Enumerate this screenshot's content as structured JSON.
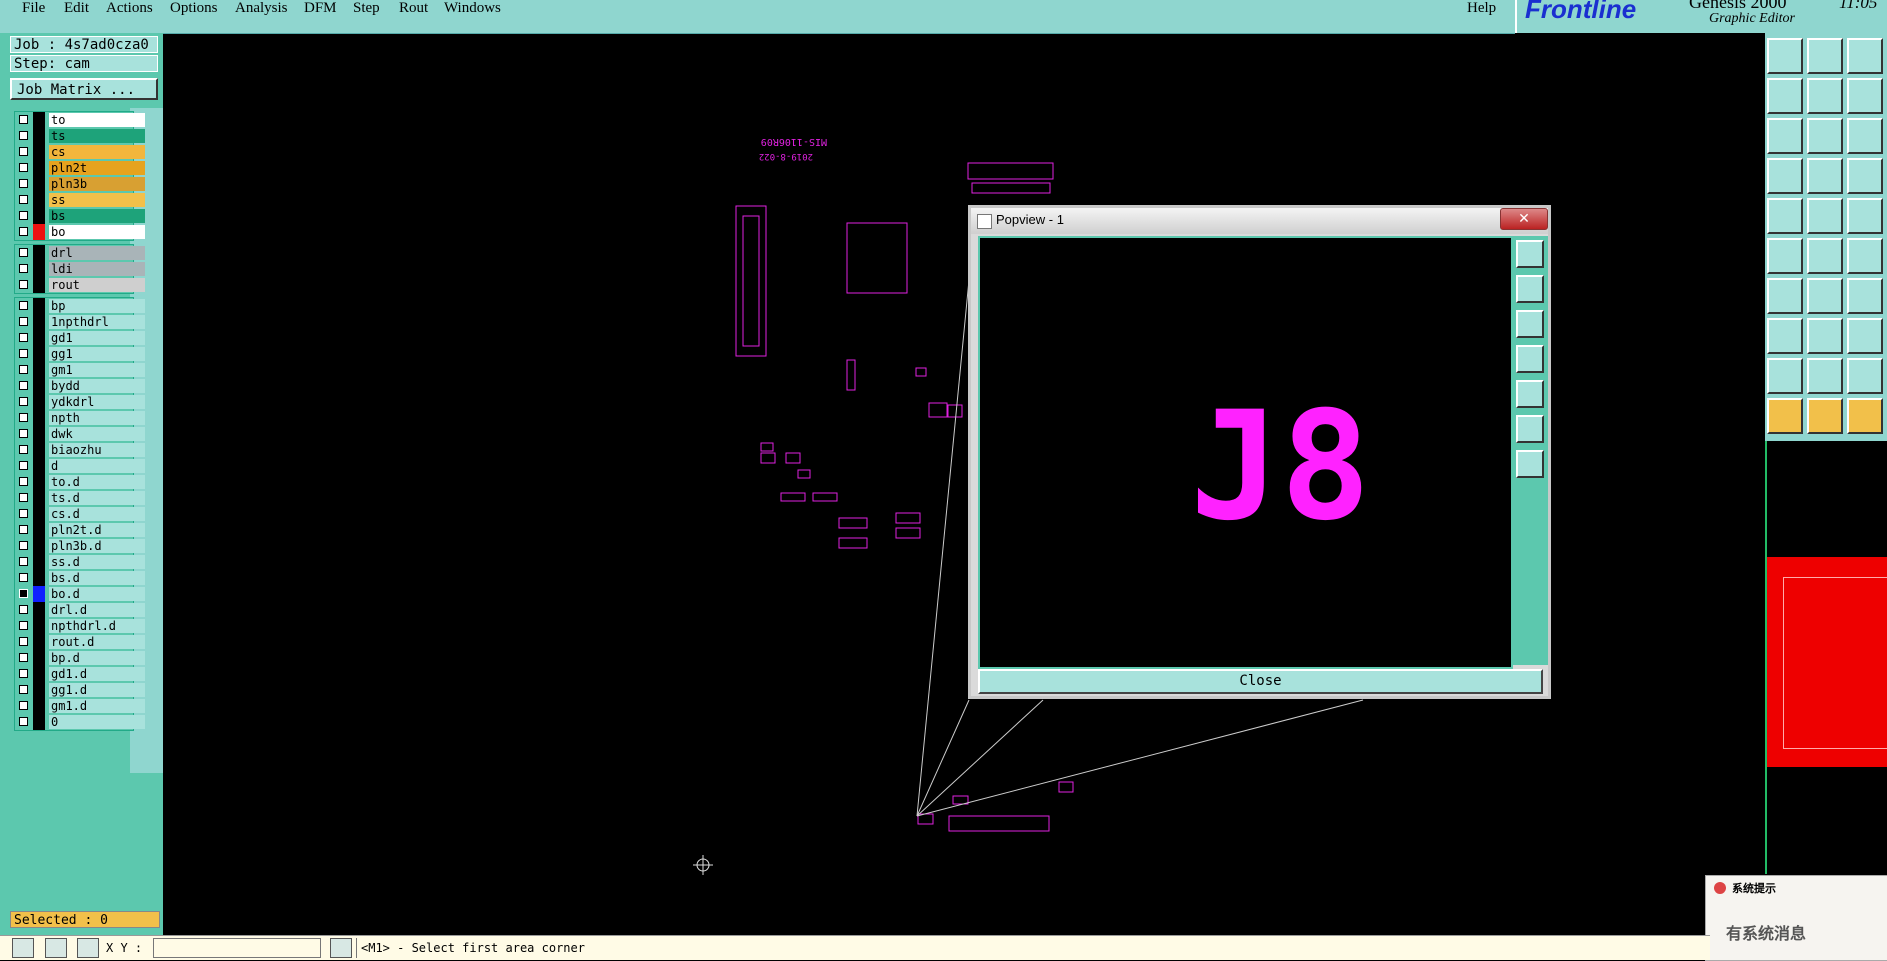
{
  "menu": [
    "File",
    "Edit",
    "Actions",
    "Options",
    "Analysis",
    "DFM",
    "Step",
    "Rout",
    "Windows"
  ],
  "help": "Help",
  "brand": {
    "logo": "Frontline",
    "product": "Genesis 2000",
    "subtitle": "Graphic Editor",
    "clock": "11:05"
  },
  "job": {
    "job_line": "Job : 4s7ad0cza0",
    "step_line": "Step: cam",
    "matrix_button": "Job Matrix ..."
  },
  "layers_board": [
    {
      "name": "to",
      "color": "#ffffff",
      "swatch": "#000000"
    },
    {
      "name": "ts",
      "color": "#1ea37a",
      "swatch": "#000000"
    },
    {
      "name": "cs",
      "color": "#f2b63c",
      "swatch": "#000000"
    },
    {
      "name": "pln2t",
      "color": "#e6a31e",
      "swatch": "#000000"
    },
    {
      "name": "pln3b",
      "color": "#d8a032",
      "swatch": "#000000"
    },
    {
      "name": "ss",
      "color": "#f2c04a",
      "swatch": "#000000"
    },
    {
      "name": "bs",
      "color": "#1ea37a",
      "swatch": "#000000"
    },
    {
      "name": "bo",
      "color": "#ffffff",
      "swatch": "#ee1111"
    }
  ],
  "layers_drill": [
    {
      "name": "drl",
      "color": "#a9b4b8"
    },
    {
      "name": "ldi",
      "color": "#a9b4b8"
    },
    {
      "name": "rout",
      "color": "#cfcfcf"
    }
  ],
  "layers_misc": [
    "bp",
    "1npthdrl",
    "gd1",
    "gg1",
    "gm1",
    "bydd",
    "ydkdrl",
    "npth",
    "dwk",
    "biaozhu",
    "d",
    "to.d",
    "ts.d",
    "cs.d",
    "pln2t.d",
    "pln3b.d",
    "ss.d",
    "bs.d",
    "bo.d",
    "drl.d",
    "npthdrl.d",
    "rout.d",
    "bp.d",
    "gd1.d",
    "gg1.d",
    "gm1.d",
    "0"
  ],
  "active_layer": "bo.d",
  "selected": "Selected : 0",
  "status": {
    "xy_label": "X Y :",
    "message": "<M1> - Select first area corner"
  },
  "popview": {
    "title": "Popview - 1",
    "zoom_text": "J8",
    "close_label": "Close",
    "close_x": "✕"
  },
  "board_text": {
    "pn": "MIS-1106R09",
    "date": "2019-8-022"
  },
  "sysnotice": {
    "title": "系统提示",
    "body": "有系统消息"
  },
  "colors": {
    "accent_teal": "#5cc8ae",
    "panel_teal": "#8fd6cf",
    "feature_magenta": "#ff22ff",
    "red": "#ee0000"
  }
}
